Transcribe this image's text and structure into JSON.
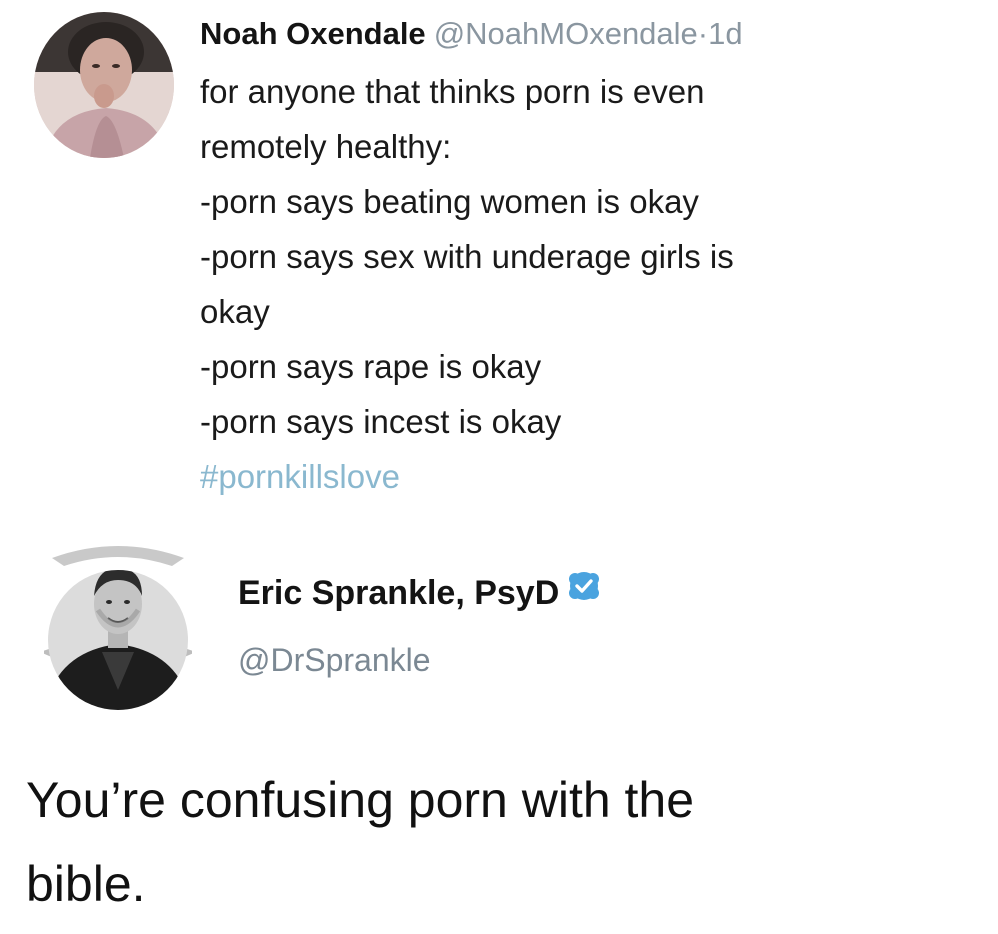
{
  "tweet1": {
    "display_name": "Noah Oxendale",
    "handle": "@NoahMOxendale",
    "separator": "·",
    "time": "1d",
    "avatar_icon": "profile-photo",
    "lines": [
      "for anyone that thinks porn is even",
      "remotely healthy:",
      "-porn says beating women is okay",
      "-porn says sex with underage girls is",
      "okay",
      "-porn says rape is okay",
      "-porn says incest is okay"
    ],
    "hashtag": "#pornkillslove",
    "hashtag_color": "#8ab8cf"
  },
  "tweet2": {
    "display_name": "Eric Sprankle, PsyD",
    "verified_icon": "verified-badge-icon",
    "verified_color": "#4aa3df",
    "handle": "@DrSprankle",
    "avatar_icon": "profile-photo",
    "lines": [
      "You’re confusing porn with the",
      "bible."
    ]
  }
}
